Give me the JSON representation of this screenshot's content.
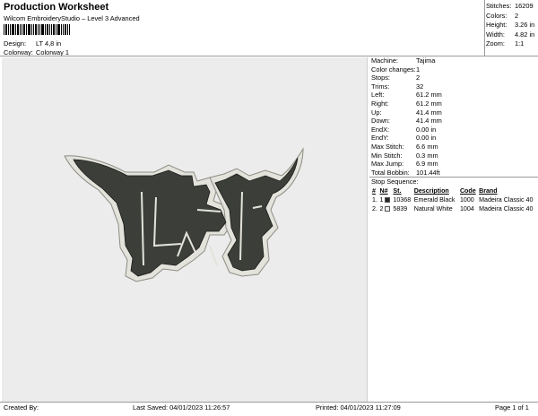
{
  "header": {
    "title": "Production Worksheet",
    "subtitle": "Wilcom EmbroideryStudio – Level 3 Advanced",
    "design_label": "Design:",
    "design_value": "LT 4,8 in",
    "colorway_label": "Colorway:",
    "colorway_value": "Colorway 1"
  },
  "summary": [
    {
      "label": "Stitches:",
      "value": "16209"
    },
    {
      "label": "Colors:",
      "value": "2"
    },
    {
      "label": "Height:",
      "value": "3.26 in"
    },
    {
      "label": "Width:",
      "value": "4.82 in"
    },
    {
      "label": "Zoom:",
      "value": "1:1"
    }
  ],
  "machine_info": [
    {
      "label": "Machine:",
      "value": "Tajima"
    },
    {
      "label": "Color changes:",
      "value": "1"
    },
    {
      "label": "Stops:",
      "value": "2"
    },
    {
      "label": "Trims:",
      "value": "32"
    },
    {
      "label": "Left:",
      "value": "61.2 mm"
    },
    {
      "label": "Right:",
      "value": "61.2 mm"
    },
    {
      "label": "Up:",
      "value": "41.4 mm"
    },
    {
      "label": "Down:",
      "value": "41.4 mm"
    },
    {
      "label": "EndX:",
      "value": "0.00 in"
    },
    {
      "label": "EndY:",
      "value": "0.00 in"
    },
    {
      "label": "Max Stitch:",
      "value": "6.6 mm"
    },
    {
      "label": "Min Stitch:",
      "value": "0.3 mm"
    },
    {
      "label": "Max Jump:",
      "value": "6.9 mm"
    },
    {
      "label": "Total Bobbin:",
      "value": "101.44ft"
    }
  ],
  "stop_sequence": {
    "title": "Stop Sequence:",
    "headers": [
      "#",
      "N#",
      "St.",
      "Description",
      "Code",
      "Brand"
    ],
    "rows": [
      {
        "num": "1.",
        "n": "1",
        "swatch": "#262626",
        "st": "10368",
        "description": "Emerald Black",
        "code": "1000",
        "brand": "Madeira Classic 40"
      },
      {
        "num": "2.",
        "n": "2",
        "swatch": "#ececec",
        "st": "5839",
        "description": "Natural White",
        "code": "1004",
        "brand": "Madeira Classic 40"
      }
    ]
  },
  "footer": {
    "created_by": "Created By:",
    "last_saved": "Last Saved: 04/01/2023 11:26:57",
    "printed": "Printed: 04/01/2023 11:27:09",
    "page": "Page 1 of 1"
  },
  "colors": {
    "thread_dark": "#3c3f39",
    "thread_light": "#e3e3dc",
    "canvas_bg": "#ececec"
  }
}
